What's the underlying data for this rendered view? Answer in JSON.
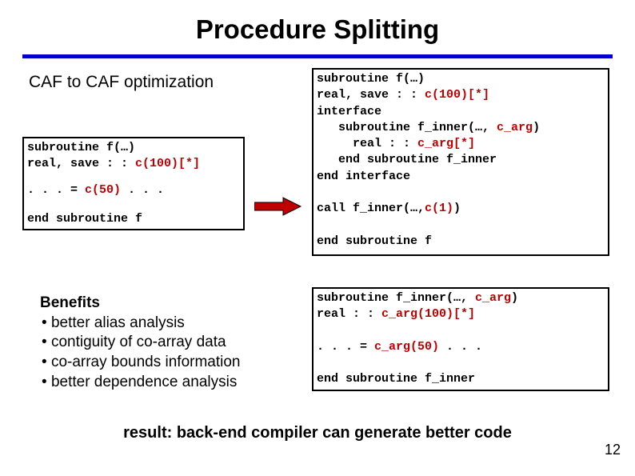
{
  "title": "Procedure Splitting",
  "subtitle": "CAF to CAF optimization",
  "left_code": {
    "l1a": "subroutine f(…)",
    "l1b": "real, save : :",
    "l1b_kw": " c(100)[*]",
    "l2a": ". . . = ",
    "l2a_kw": "c(50)",
    "l2b": " . . .",
    "l3": "end subroutine f"
  },
  "right1": {
    "r1": "subroutine f(…)",
    "r2a": "real, save : :",
    "r2b_kw": " c(100)[*]",
    "r3": "interface",
    "r4a": "   subroutine f_inner(…,",
    "r4b_kw": " c_arg",
    "r4c": ")",
    "r5a": "     real : :",
    "r5b_kw": " c_arg[*]",
    "r6": "   end subroutine f_inner",
    "r7": "end interface",
    "r8a": "call f_inner(…,",
    "r8b_kw": "c(1)",
    "r8c": ")",
    "r9": "end subroutine f"
  },
  "right2": {
    "s1a": "subroutine f_inner(…,",
    "s1b_kw": " c_arg",
    "s1c": ")",
    "s2a": "real : :",
    "s2b_kw": " c_arg(100)[*]",
    "s3a": ". . . = ",
    "s3b_kw": "c_arg(50)",
    "s3c": " . . .",
    "s4": "end subroutine f_inner"
  },
  "benefits": {
    "heading": "Benefits",
    "items": [
      "better alias analysis",
      "contiguity of co-array data",
      "co-array bounds information",
      "better dependence analysis"
    ]
  },
  "result": "result: back-end compiler can generate better code",
  "pagenum": "12",
  "colors": {
    "accent": "#0000cc",
    "keyword": "#c00000"
  }
}
